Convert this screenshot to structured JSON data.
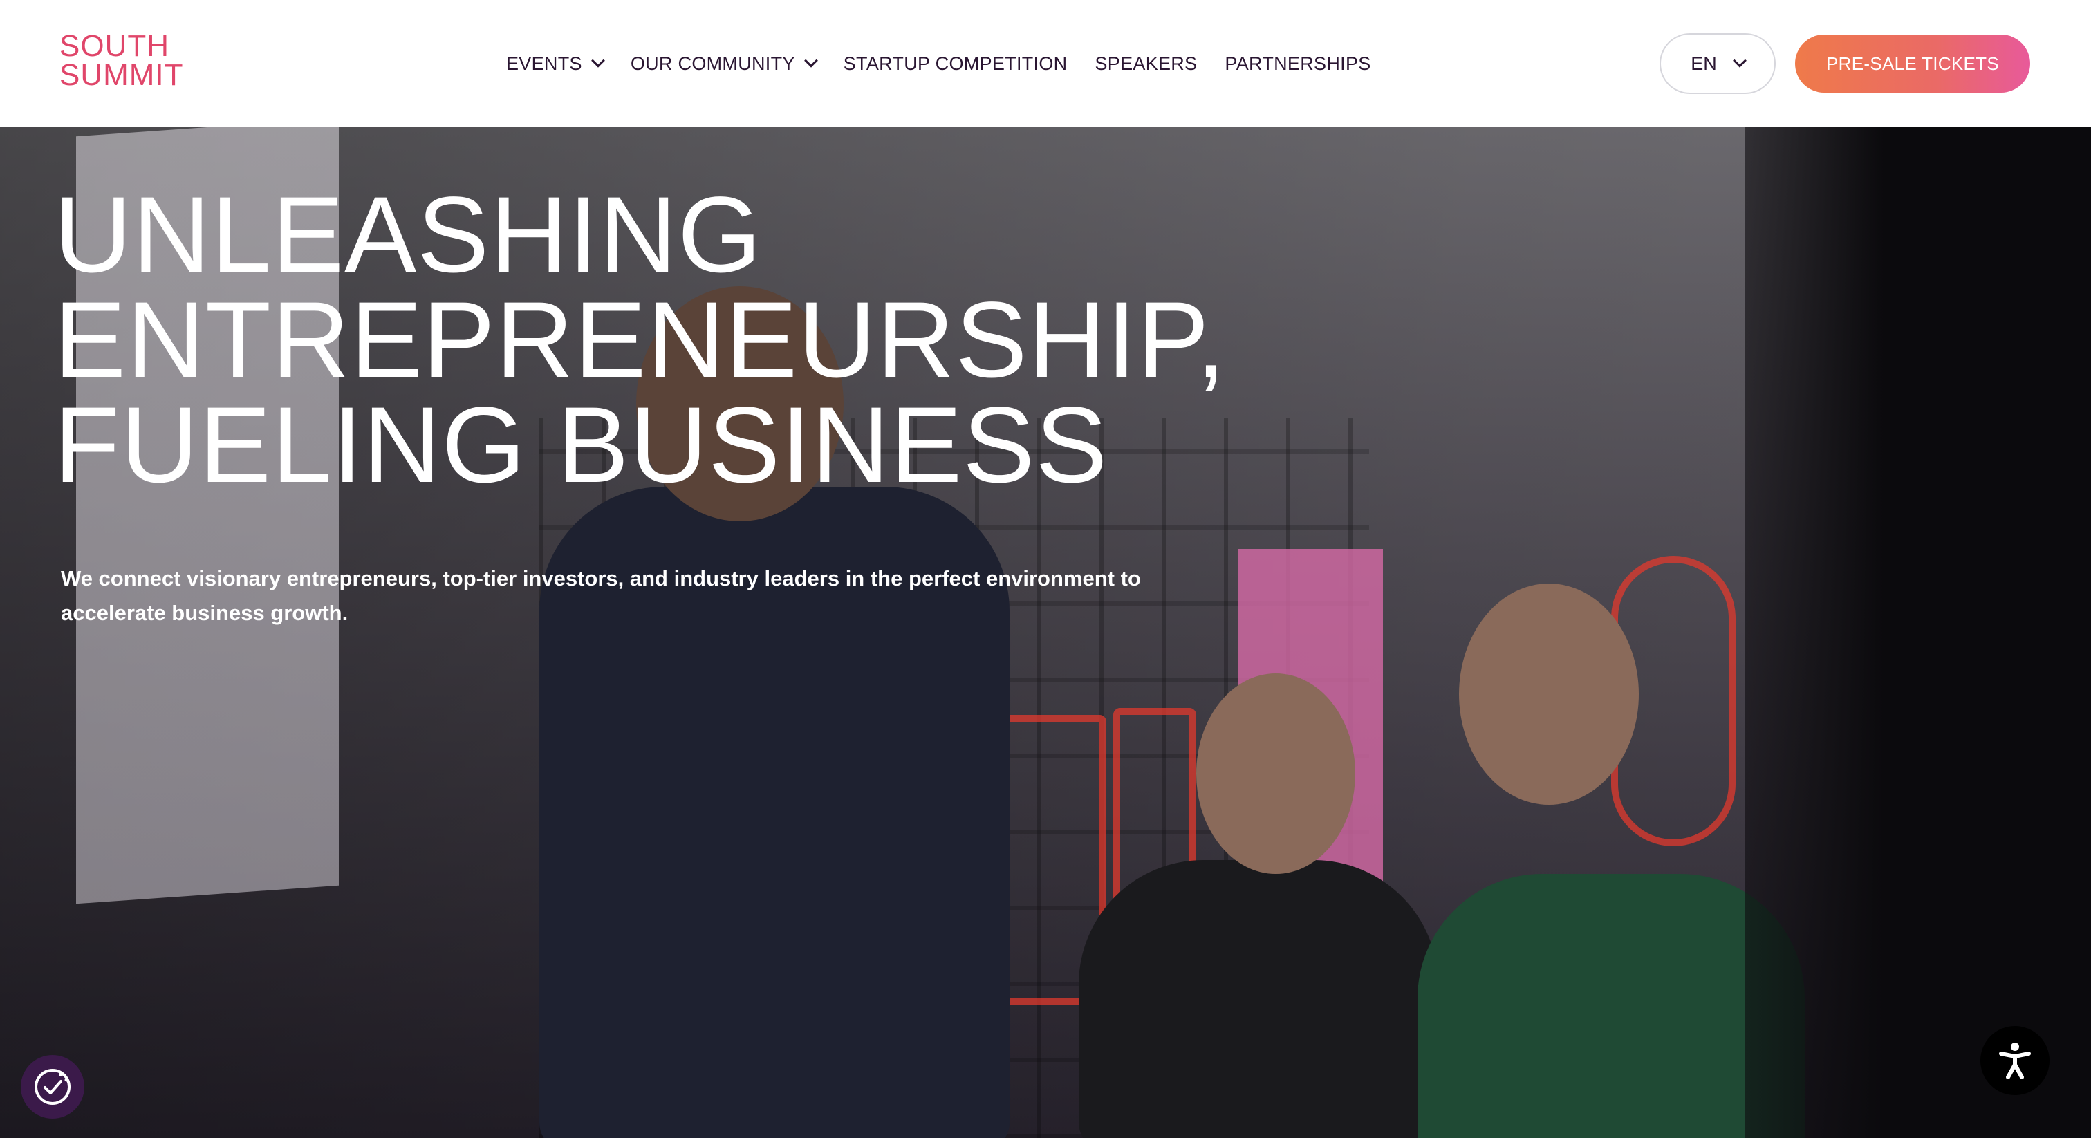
{
  "header": {
    "logo_line1": "SOUTH",
    "logo_line2": "SUMMIT",
    "nav": [
      {
        "label": "EVENTS",
        "has_dropdown": true
      },
      {
        "label": "OUR COMMUNITY",
        "has_dropdown": true
      },
      {
        "label": "STARTUP COMPETITION",
        "has_dropdown": false
      },
      {
        "label": "SPEAKERS",
        "has_dropdown": false
      },
      {
        "label": "PARTNERSHIPS",
        "has_dropdown": false
      }
    ],
    "language": "EN",
    "cta_label": "PRE-SALE TICKETS"
  },
  "hero": {
    "title_line1": "UNLEASHING",
    "title_line2": "ENTREPRENEURSHIP,",
    "title_line3": "FUELING BUSINESS",
    "subtitle": "We connect visionary entrepreneurs, top-tier investors, and industry leaders in the perfect environment to accelerate business growth."
  },
  "widgets": {
    "consent_icon": "cookie-consent-icon",
    "accessibility_icon": "accessibility-icon"
  },
  "colors": {
    "brand": "#e0466a",
    "nav_text": "#2a1632",
    "cta_gradient_start": "#ef7a4a",
    "cta_gradient_end": "#e85a9a"
  }
}
